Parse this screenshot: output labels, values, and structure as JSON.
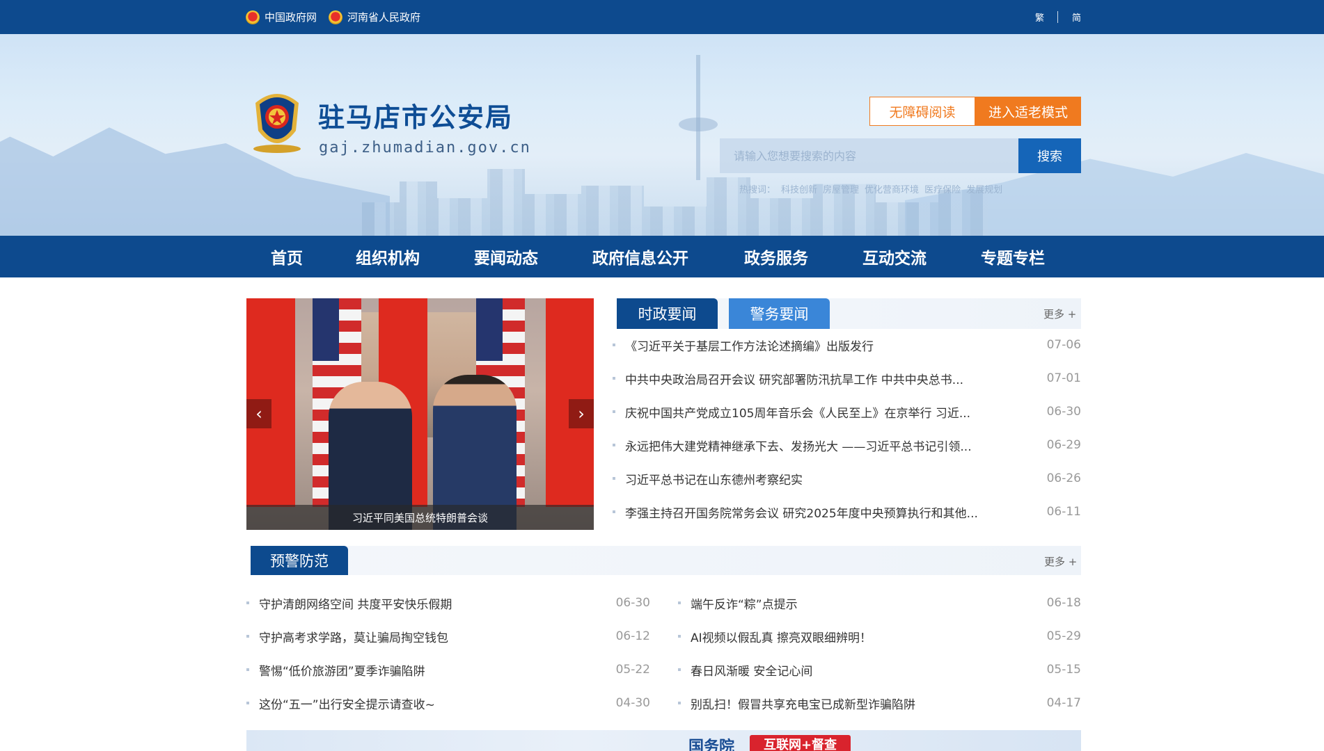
{
  "topbar": {
    "links": [
      "中国政府网",
      "河南省人民政府"
    ],
    "lang": [
      "繁",
      "简"
    ]
  },
  "header": {
    "site_name": "驻马店市公安局",
    "domain": "gaj.zhumadian.gov.cn",
    "accessibility_label": "无障碍阅读",
    "elder_mode_label": "进入适老模式",
    "search_placeholder": "请输入您想要搜索的内容",
    "search_label": "搜索",
    "hot_label": "热搜词：",
    "hot_words": [
      "科技创新",
      "房屋管理",
      "优化营商环境",
      "医疗保险",
      "发展规划"
    ]
  },
  "nav": [
    "首页",
    "组织机构",
    "要闻动态",
    "政府信息公开",
    "政务服务",
    "互动交流",
    "专题专栏"
  ],
  "carousel": {
    "caption": "习近平同美国总统特朗普会谈",
    "prev": "‹",
    "next": "›"
  },
  "news": {
    "tabs": [
      "时政要闻",
      "警务要闻"
    ],
    "more": "更多 +",
    "items": [
      {
        "title": "《习近平关于基层工作方法论述摘编》出版发行",
        "date": "07-06"
      },
      {
        "title": "中共中央政治局召开会议 研究部署防汛抗旱工作 中共中央总书...",
        "date": "07-01"
      },
      {
        "title": "庆祝中国共产党成立105周年音乐会《人民至上》在京举行 习近...",
        "date": "06-30"
      },
      {
        "title": "永远把伟大建党精神继承下去、发扬光大 ——习近平总书记引领...",
        "date": "06-29"
      },
      {
        "title": "习近平总书记在山东德州考察纪实",
        "date": "06-26"
      },
      {
        "title": "李强主持召开国务院常务会议 研究2025年度中央预算执行和其他...",
        "date": "06-11"
      }
    ]
  },
  "warning": {
    "title": "预警防范",
    "more": "更多 +",
    "left": [
      {
        "title": "守护清朗网络空间 共度平安快乐假期",
        "date": "06-30"
      },
      {
        "title": "守护高考求学路，莫让骗局掏空钱包",
        "date": "06-12"
      },
      {
        "title": "警惕“低价旅游团”夏季诈骗陷阱",
        "date": "05-22"
      },
      {
        "title": "这份“五一”出行安全提示请查收~",
        "date": "04-30"
      }
    ],
    "right": [
      {
        "title": "端午反诈“粽”点提示",
        "date": "06-18"
      },
      {
        "title": "AI视频以假乱真 擦亮双眼细辨明！",
        "date": "05-29"
      },
      {
        "title": "春日风渐暖 安全记心间",
        "date": "05-15"
      },
      {
        "title": "别乱扫！假冒共享充电宝已成新型诈骗陷阱",
        "date": "04-17"
      }
    ]
  },
  "bottom_banner": {
    "text": "国务院",
    "badge": "互联网+督查"
  },
  "colors": {
    "primary": "#0d4a8e",
    "accent": "#f07a1f",
    "tab_secondary": "#3a86d8",
    "badge_red": "#d9232d"
  }
}
